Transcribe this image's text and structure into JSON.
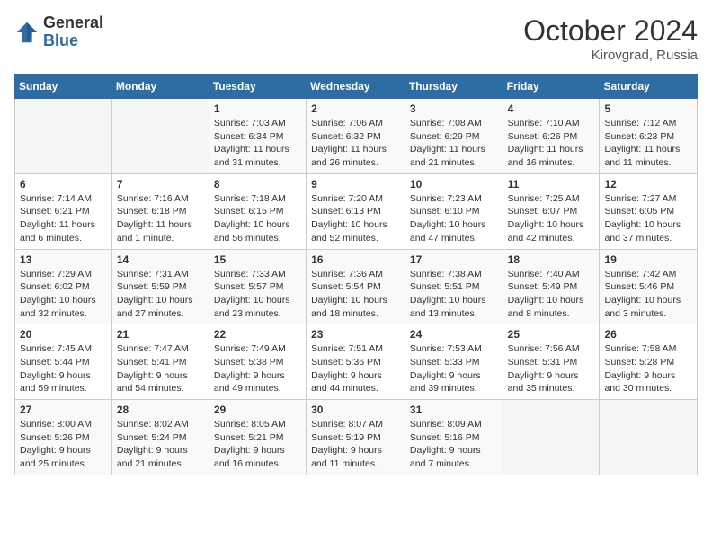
{
  "header": {
    "logo_general": "General",
    "logo_blue": "Blue",
    "month_title": "October 2024",
    "location": "Kirovgrad, Russia"
  },
  "days_of_week": [
    "Sunday",
    "Monday",
    "Tuesday",
    "Wednesday",
    "Thursday",
    "Friday",
    "Saturday"
  ],
  "weeks": [
    [
      {
        "day": "",
        "empty": true
      },
      {
        "day": "",
        "empty": true
      },
      {
        "day": "1",
        "sunrise": "7:03 AM",
        "sunset": "6:34 PM",
        "daylight": "11 hours and 31 minutes."
      },
      {
        "day": "2",
        "sunrise": "7:06 AM",
        "sunset": "6:32 PM",
        "daylight": "11 hours and 26 minutes."
      },
      {
        "day": "3",
        "sunrise": "7:08 AM",
        "sunset": "6:29 PM",
        "daylight": "11 hours and 21 minutes."
      },
      {
        "day": "4",
        "sunrise": "7:10 AM",
        "sunset": "6:26 PM",
        "daylight": "11 hours and 16 minutes."
      },
      {
        "day": "5",
        "sunrise": "7:12 AM",
        "sunset": "6:23 PM",
        "daylight": "11 hours and 11 minutes."
      }
    ],
    [
      {
        "day": "6",
        "sunrise": "7:14 AM",
        "sunset": "6:21 PM",
        "daylight": "11 hours and 6 minutes."
      },
      {
        "day": "7",
        "sunrise": "7:16 AM",
        "sunset": "6:18 PM",
        "daylight": "11 hours and 1 minute."
      },
      {
        "day": "8",
        "sunrise": "7:18 AM",
        "sunset": "6:15 PM",
        "daylight": "10 hours and 56 minutes."
      },
      {
        "day": "9",
        "sunrise": "7:20 AM",
        "sunset": "6:13 PM",
        "daylight": "10 hours and 52 minutes."
      },
      {
        "day": "10",
        "sunrise": "7:23 AM",
        "sunset": "6:10 PM",
        "daylight": "10 hours and 47 minutes."
      },
      {
        "day": "11",
        "sunrise": "7:25 AM",
        "sunset": "6:07 PM",
        "daylight": "10 hours and 42 minutes."
      },
      {
        "day": "12",
        "sunrise": "7:27 AM",
        "sunset": "6:05 PM",
        "daylight": "10 hours and 37 minutes."
      }
    ],
    [
      {
        "day": "13",
        "sunrise": "7:29 AM",
        "sunset": "6:02 PM",
        "daylight": "10 hours and 32 minutes."
      },
      {
        "day": "14",
        "sunrise": "7:31 AM",
        "sunset": "5:59 PM",
        "daylight": "10 hours and 27 minutes."
      },
      {
        "day": "15",
        "sunrise": "7:33 AM",
        "sunset": "5:57 PM",
        "daylight": "10 hours and 23 minutes."
      },
      {
        "day": "16",
        "sunrise": "7:36 AM",
        "sunset": "5:54 PM",
        "daylight": "10 hours and 18 minutes."
      },
      {
        "day": "17",
        "sunrise": "7:38 AM",
        "sunset": "5:51 PM",
        "daylight": "10 hours and 13 minutes."
      },
      {
        "day": "18",
        "sunrise": "7:40 AM",
        "sunset": "5:49 PM",
        "daylight": "10 hours and 8 minutes."
      },
      {
        "day": "19",
        "sunrise": "7:42 AM",
        "sunset": "5:46 PM",
        "daylight": "10 hours and 3 minutes."
      }
    ],
    [
      {
        "day": "20",
        "sunrise": "7:45 AM",
        "sunset": "5:44 PM",
        "daylight": "9 hours and 59 minutes."
      },
      {
        "day": "21",
        "sunrise": "7:47 AM",
        "sunset": "5:41 PM",
        "daylight": "9 hours and 54 minutes."
      },
      {
        "day": "22",
        "sunrise": "7:49 AM",
        "sunset": "5:38 PM",
        "daylight": "9 hours and 49 minutes."
      },
      {
        "day": "23",
        "sunrise": "7:51 AM",
        "sunset": "5:36 PM",
        "daylight": "9 hours and 44 minutes."
      },
      {
        "day": "24",
        "sunrise": "7:53 AM",
        "sunset": "5:33 PM",
        "daylight": "9 hours and 39 minutes."
      },
      {
        "day": "25",
        "sunrise": "7:56 AM",
        "sunset": "5:31 PM",
        "daylight": "9 hours and 35 minutes."
      },
      {
        "day": "26",
        "sunrise": "7:58 AM",
        "sunset": "5:28 PM",
        "daylight": "9 hours and 30 minutes."
      }
    ],
    [
      {
        "day": "27",
        "sunrise": "8:00 AM",
        "sunset": "5:26 PM",
        "daylight": "9 hours and 25 minutes."
      },
      {
        "day": "28",
        "sunrise": "8:02 AM",
        "sunset": "5:24 PM",
        "daylight": "9 hours and 21 minutes."
      },
      {
        "day": "29",
        "sunrise": "8:05 AM",
        "sunset": "5:21 PM",
        "daylight": "9 hours and 16 minutes."
      },
      {
        "day": "30",
        "sunrise": "8:07 AM",
        "sunset": "5:19 PM",
        "daylight": "9 hours and 11 minutes."
      },
      {
        "day": "31",
        "sunrise": "8:09 AM",
        "sunset": "5:16 PM",
        "daylight": "9 hours and 7 minutes."
      },
      {
        "day": "",
        "empty": true
      },
      {
        "day": "",
        "empty": true
      }
    ]
  ]
}
